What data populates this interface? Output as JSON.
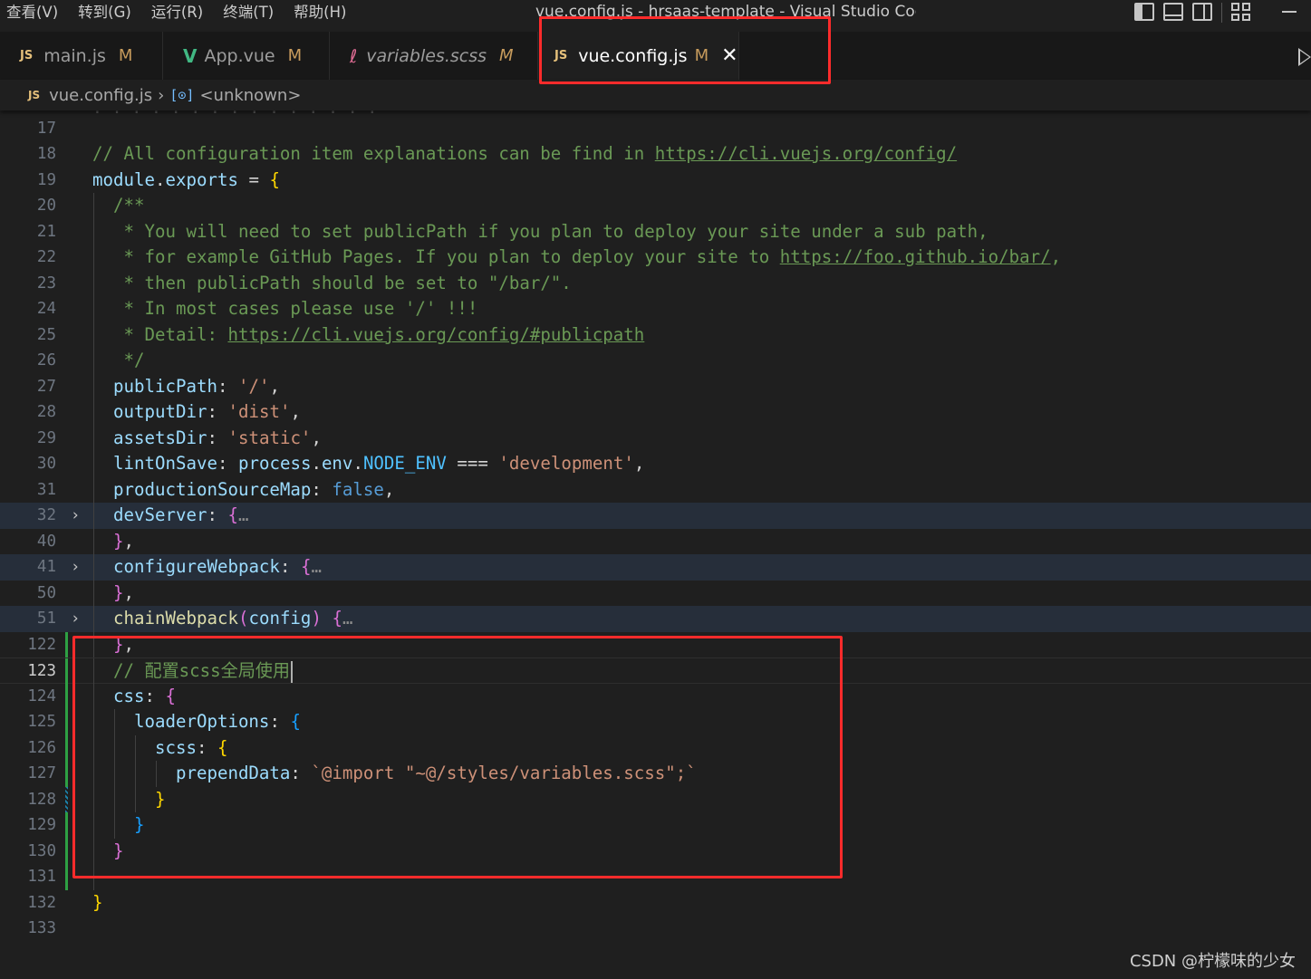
{
  "menu": [
    "查看(V)",
    "转到(G)",
    "运行(R)",
    "终端(T)",
    "帮助(H)"
  ],
  "window_title": "vue.config.js - hrsaas-template - Visual Studio Code",
  "tabs": [
    {
      "icon": "JS",
      "name": "main.js",
      "status": "M",
      "active": false,
      "italic": false
    },
    {
      "icon": "V",
      "name": "App.vue",
      "status": "M",
      "active": false,
      "italic": false
    },
    {
      "icon": "scss",
      "name": "variables.scss",
      "status": "M",
      "active": false,
      "italic": true
    },
    {
      "icon": "JS",
      "name": "vue.config.js",
      "status": "M",
      "active": true,
      "italic": false,
      "close": "✕"
    }
  ],
  "breadcrumb": {
    "icon": "JS",
    "file": "vue.config.js",
    "separator": "›",
    "symbol_icon": "[⊙]",
    "symbol": "<unknown>"
  },
  "editor": {
    "language": "javascript",
    "cursor_line": 123,
    "lines": [
      {
        "n": "17",
        "text": ""
      },
      {
        "n": "18",
        "text": "// All configuration item explanations can be find in https://cli.vuejs.org/config/"
      },
      {
        "n": "19",
        "text": "module.exports = {"
      },
      {
        "n": "20",
        "text": "  /**"
      },
      {
        "n": "21",
        "text": "   * You will need to set publicPath if you plan to deploy your site under a sub path,"
      },
      {
        "n": "22",
        "text": "   * for example GitHub Pages. If you plan to deploy your site to https://foo.github.io/bar/,"
      },
      {
        "n": "23",
        "text": "   * then publicPath should be set to \"/bar/\"."
      },
      {
        "n": "24",
        "text": "   * In most cases please use '/' !!!"
      },
      {
        "n": "25",
        "text": "   * Detail: https://cli.vuejs.org/config/#publicpath"
      },
      {
        "n": "26",
        "text": "   */"
      },
      {
        "n": "27",
        "text": "  publicPath: '/',"
      },
      {
        "n": "28",
        "text": "  outputDir: 'dist',"
      },
      {
        "n": "29",
        "text": "  assetsDir: 'static',"
      },
      {
        "n": "30",
        "text": "  lintOnSave: process.env.NODE_ENV === 'development',"
      },
      {
        "n": "31",
        "text": "  productionSourceMap: false,"
      },
      {
        "n": "32",
        "text": "  devServer: {…",
        "folded": true
      },
      {
        "n": "40",
        "text": "  },"
      },
      {
        "n": "41",
        "text": "  configureWebpack: {…",
        "folded": true
      },
      {
        "n": "50",
        "text": "  },"
      },
      {
        "n": "51",
        "text": "  chainWebpack(config) {…",
        "folded": true
      },
      {
        "n": "122",
        "text": "  },"
      },
      {
        "n": "123",
        "text": "  // 配置scss全局使用"
      },
      {
        "n": "124",
        "text": "  css: {"
      },
      {
        "n": "125",
        "text": "    loaderOptions: {"
      },
      {
        "n": "126",
        "text": "      scss: {"
      },
      {
        "n": "127",
        "text": "        prependData: `@import \"~@/styles/variables.scss\";`"
      },
      {
        "n": "128",
        "text": "      }"
      },
      {
        "n": "129",
        "text": "    }"
      },
      {
        "n": "130",
        "text": "  }"
      },
      {
        "n": "131",
        "text": ""
      },
      {
        "n": "132",
        "text": "}"
      },
      {
        "n": "133",
        "text": ""
      }
    ]
  },
  "watermark": "CSDN @柠檬味的少女",
  "colors": {
    "annotation_box": "#ff2b2b",
    "editor_bg": "#1f1f1f",
    "comment": "#6a9955",
    "string": "#ce9178",
    "property": "#9cdcfe"
  }
}
